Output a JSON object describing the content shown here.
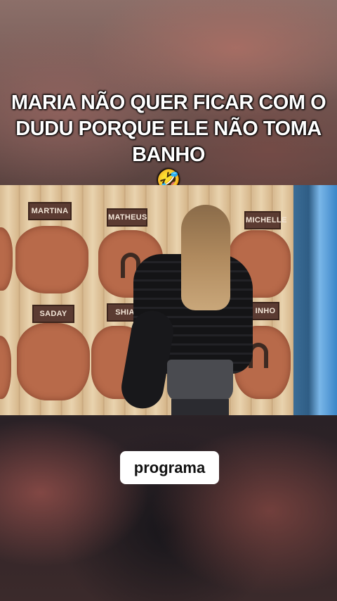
{
  "caption": {
    "text": "MARIA NÃO QUER FICAR COM O DUDU PORQUE ELE NÃO TOMA BANHO",
    "emoji": "🤣"
  },
  "scene": {
    "name_plates": [
      "MARTINA",
      "MATHEUS",
      "MICHELLE",
      "SADAY",
      "SHIA",
      "INHO"
    ],
    "icons": [
      "horseshoe-icon",
      "horseshoe-icon",
      "horseshoe-icon"
    ]
  },
  "subtitle_chip": {
    "text": "programa"
  }
}
